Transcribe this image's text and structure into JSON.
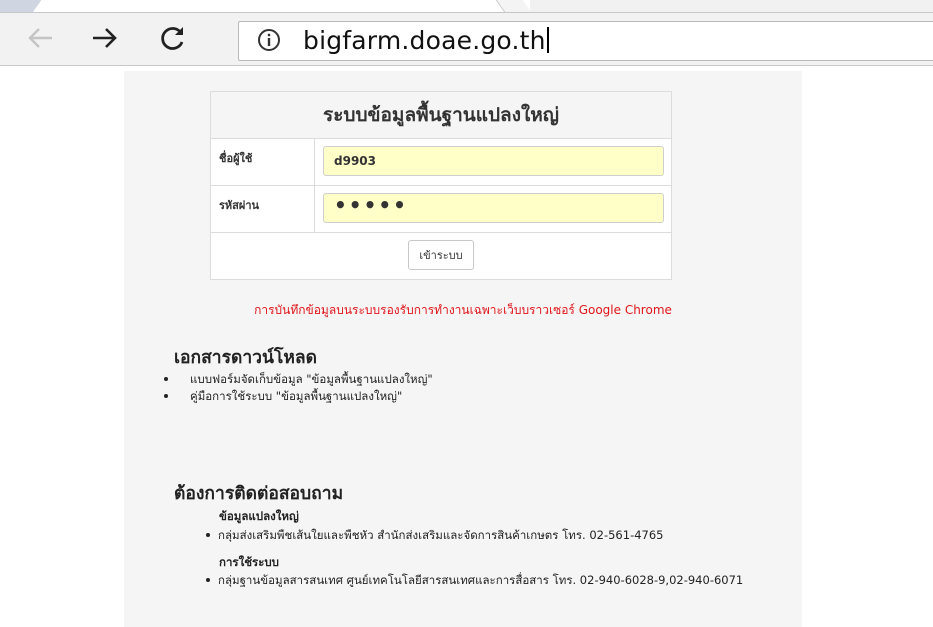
{
  "browser": {
    "url": "bigfarm.doae.go.th"
  },
  "login": {
    "title": "ระบบข้อมูลพื้นฐานแปลงใหญ่",
    "username_label": "ชื่อผู้ใช้",
    "username_value": "d9903",
    "password_label": "รหัสผ่าน",
    "password_value": "•••••",
    "submit_label": "เข้าระบบ"
  },
  "notice": "การบันทึกข้อมูลบนระบบรองรับการทำงานเฉพาะเว็บบราวเซอร์ Google Chrome",
  "downloads": {
    "heading": "เอกสารดาวน์โหลด",
    "items": [
      "แบบฟอร์มจัดเก็บข้อมูล \"ข้อมูลพื้นฐานแปลงใหญ่\"",
      "คู่มือการใช้ระบบ \"ข้อมูลพื้นฐานแปลงใหญ่\""
    ]
  },
  "contact": {
    "heading": "ต้องการติดต่อสอบถาม",
    "groups": [
      {
        "title": "ข้อมูลแปลงใหญ่",
        "item": "กลุ่มส่งเสริมพืชเส้นใยและพืชหัว สำนักส่งเสริมและจัดการสินค้าเกษตร โทร. 02-561-4765"
      },
      {
        "title": "การใช้ระบบ",
        "item": "กลุ่มฐานข้อมูลสารสนเทศ ศูนย์เทคโนโลยีสารสนเทศและการสื่อสาร โทร. 02-940-6028-9,02-940-6071"
      }
    ]
  }
}
